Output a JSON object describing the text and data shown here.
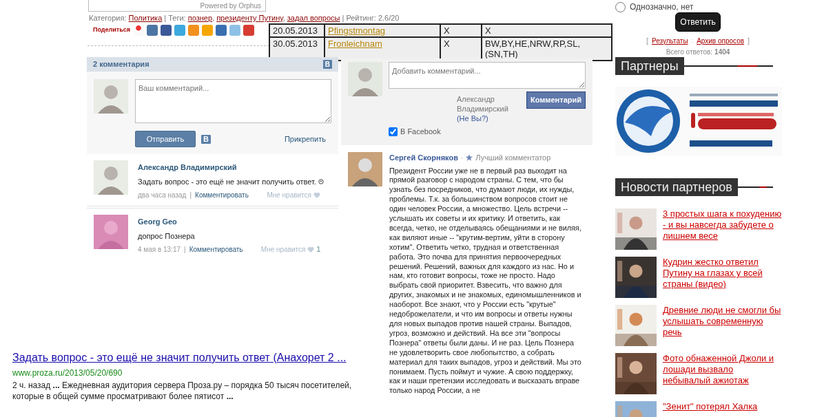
{
  "orphus": {
    "label": "Powered by Orphus"
  },
  "article_meta": {
    "category_label": "Категория:",
    "category": "Политика",
    "tags_label": "| Теги:",
    "tags": [
      "познер",
      "президенту Путину",
      "задал вопросы"
    ],
    "tag_separator": ",",
    "rating": "| Рейтинг: 2.6/20"
  },
  "share": {
    "label": "Поделиться"
  },
  "holidays": {
    "rows": [
      {
        "date": "20.05.2013",
        "name": "Pfingstmontag",
        "column_3": "X",
        "column_4": "X"
      },
      {
        "date": "30.05.2013",
        "name": "Fronleichnam",
        "column_3": "X",
        "column_4": "BW,BY,HE,NRW,RP,SL, (SN,TH)"
      }
    ]
  },
  "vk_comments": {
    "title": "2 комментария",
    "badge": "B",
    "placeholder": "Ваш комментарий...",
    "send": "Отправить",
    "send_badge": "B",
    "attach": "Прикрепить",
    "comments": [
      {
        "author": "Александр Владимирский",
        "text": "Задать вопрос - это ещё не значит получить ответ.",
        "time": "два часа назад",
        "separator": "|",
        "reply": "Комментировать",
        "like": "Мне нравится"
      },
      {
        "author": "Georg Geo",
        "text": "допрос Познера",
        "time": "4 мая в 13:17",
        "separator": "|",
        "reply": "Комментировать",
        "like": "Мне нравится",
        "likes": "1"
      }
    ]
  },
  "fb_comments": {
    "placeholder": "Добавить комментарий...",
    "user": "Александр Владимирский",
    "not_you": "(Не Вы?)",
    "submit": "Комментарий",
    "post_to_facebook": {
      "label": "В Facebook",
      "checked": true
    },
    "comment": {
      "author": "Сергей Скорняков",
      "separator": "·",
      "badge": "Лучший комментатор",
      "text": "Президент России уже не в первый раз выходит на прямой разговор с народом страны. С тем, что бы узнать без посредников, что думают люди, их нужды, проблемы. Т.к. за большинством вопросов стоит не один человек России, а множество. Цель встречи -- услышать их советы и их критику. И ответить, как всегда, четко, не отделываясь обещаниями и не виляя, как виляют иные -- \"крутим-вертим, уйти в сторону хотим\". Ответить четко, трудная и ответственная работа. Это почва для принятия первоочередных решений. Решений, важных для каждого из нас. Но и нам, кто готовит вопросы, тоже не просто. Надо выбрать свой приоритет. Взвесить, что важно для других, знакомых и не знакомых, единомышленников и наоборот. Все знают, что у России есть \"крутые\" недоброжелатели, и что им вопросы и ответы нужны для новых выпадов против нашей страны. Выпадов, угроз, возможно и действий. На все эти \"вопросы Познера\" ответы были даны. И не раз. Цель Познера не удовлетворить свое любопытство, а собрать материал для таких выпадов, угроз и действий. Мы это понимаем. Пусть поймут и чужие. А свою поддержку, как и наши претензии исследовать и высказать вправе только народ России, а не"
    }
  },
  "search_result": {
    "title": "Задать вопрос - это ещё не значит получить ответ (Анахорет 2 ...",
    "url": "www.proza.ru/2013/05/20/690",
    "snippet": "2 ч. назад **...** Ежедневная аудитория сервера Проза.ру – порядка 50 тысяч посетителей, которые в общей сумме просматривают более пятисот **...**"
  },
  "poll": {
    "option": {
      "label": "Однозначно, нет",
      "selected": false
    },
    "submit": "Ответить",
    "bracket_open": "[",
    "links": [
      "Результаты",
      "Архив опросов"
    ],
    "link_separator": ":",
    "bracket_close": "]",
    "total_label": "Всего ответов:",
    "total": "1404"
  },
  "partners": {
    "title": "Партнеры"
  },
  "partner_news": {
    "title": "Новости партнеров",
    "items": [
      {
        "title": "3 простых шага к похудению - и вы навсегда забудете о лишнем весе"
      },
      {
        "title": "Кудрин жестко ответил Путину на глазах у всей страны (видео)"
      },
      {
        "title": "Древние люди не смогли бы услышать современную речь"
      },
      {
        "title": "Фото обнаженной Джоли и лошади вызвало небывалый ажиотаж"
      },
      {
        "title": "\"Зенит\" потерял Халка"
      }
    ]
  }
}
